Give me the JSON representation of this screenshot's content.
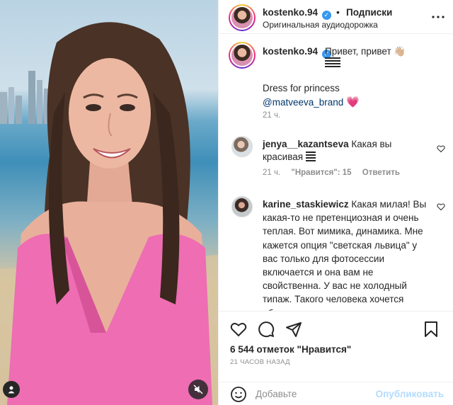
{
  "colors": {
    "link": "#00376b",
    "verified": "#3897f0",
    "publish_disabled": "#b3dbff",
    "muted": "#8e8e8e"
  },
  "header": {
    "username": "kostenko.94",
    "separator": "•",
    "follow_label": "Подписки",
    "audio_label": "Оригинальная аудиодорожка"
  },
  "caption": {
    "username": "kostenko.94",
    "text": "Привет, привет 👋🏼",
    "line2": "Dress for princess",
    "mention": "@matveeva_brand",
    "emoji": "💗",
    "time": "21 ч."
  },
  "comments": [
    {
      "username": "jenya__kazantseva",
      "text": "Какая вы красивая",
      "time": "21 ч.",
      "likes_label": "\"Нравится\": 15",
      "reply_label": "Ответить"
    },
    {
      "username": "karine_staskiewicz",
      "text": "Какая милая! Вы какая-то не претенциозная и очень теплая. Вот мимика, динамика. Мне кажется опция \"светская львица\" у вас только для фотосессии включается и она вам не свойственна. У вас не холодный типаж. Такого человека хочется обнять, или"
    }
  ],
  "likes": "6 544 отметок \"Нравится\"",
  "post_time": "21 ЧАСОВ НАЗАД",
  "comment_box": {
    "placeholder": "Добавьте",
    "publish_label": "Опубликовать"
  },
  "icons": [
    "verified-icon",
    "more-icon",
    "heart-icon",
    "comment-icon",
    "share-icon",
    "bookmark-icon",
    "emoji-icon",
    "user-icon",
    "mute-icon"
  ]
}
